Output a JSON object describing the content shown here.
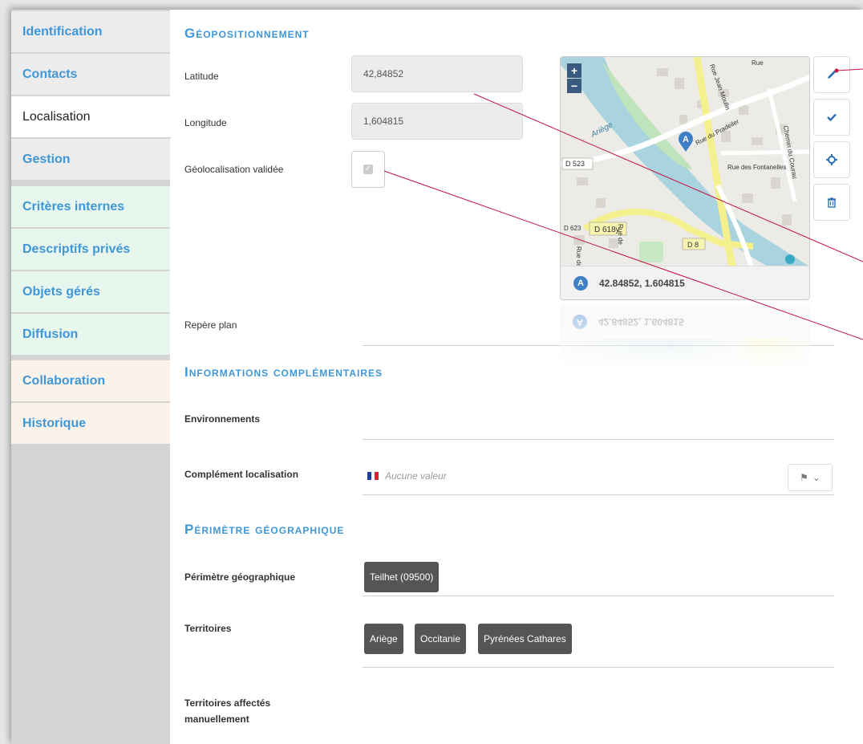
{
  "sidebar": {
    "items": [
      {
        "label": "Identification"
      },
      {
        "label": "Contacts"
      },
      {
        "label": "Localisation"
      },
      {
        "label": "Gestion"
      },
      {
        "label": "Critères internes"
      },
      {
        "label": "Descriptifs privés"
      },
      {
        "label": "Objets gérés"
      },
      {
        "label": "Diffusion"
      },
      {
        "label": "Collaboration"
      },
      {
        "label": "Historique"
      }
    ]
  },
  "geo": {
    "title": "Géopositionnement",
    "latitude_label": "Latitude",
    "latitude_value": "42,84852",
    "longitude_label": "Longitude",
    "longitude_value": "1,604815",
    "validated_label": "Géolocalisation validée",
    "validated": true,
    "plan_label": "Repère plan"
  },
  "map": {
    "zoom_in": "+",
    "zoom_out": "−",
    "footer_badge": "A",
    "footer_coords": "42.84852, 1.604815",
    "road_labels": {
      "d523": "D 523",
      "d618y": "D 618y",
      "d8": "D 8",
      "d623": "D 623",
      "river": "Ariège",
      "pradeiler": "Rue du Pradeiler",
      "fontanelles": "Rue des Fontanelles",
      "jean_moulin": "Rue Jean Moulin",
      "courau": "Chemin du Courau",
      "rue": "Rue",
      "rue_de": "Rue de",
      "rue_des": "Rue des"
    },
    "buttons": {
      "edit": "pencil-icon",
      "validate": "check-icon",
      "locate": "crosshair-icon",
      "delete": "trash-icon"
    },
    "colors": {
      "water": "#a9d3df",
      "park": "#bfe3bb",
      "land": "#ecebe6",
      "road_major": "#f3f08d",
      "pin": "#3f7fc6"
    }
  },
  "info": {
    "title": "Informations complémentaires",
    "env_label": "Environnements",
    "complement_label": "Complément localisation",
    "complement_placeholder": "Aucune valeur"
  },
  "perimetre": {
    "title": "Périmètre géographique",
    "perimetre_label": "Périmètre géographique",
    "perimetre_tag": "Teilhet (09500)",
    "territoires_label": "Territoires",
    "territoires_tags": [
      "Ariège",
      "Occitanie",
      "Pyrénées Cathares"
    ],
    "manual_label_line1": "Territoires affectés",
    "manual_label_line2": "manuellement"
  },
  "callout_color": "#c3123f"
}
